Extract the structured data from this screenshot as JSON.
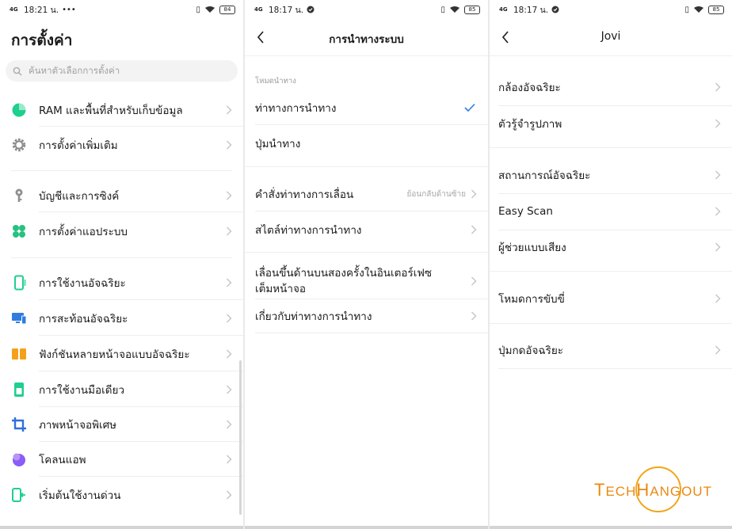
{
  "screen1": {
    "status": {
      "signal": "4G",
      "time": "18:21 น.",
      "extra": "•••",
      "battery": "84"
    },
    "title": "การตั้งค่า",
    "search_placeholder": "ค้นหาตัวเลือกการตั้งค่า",
    "items": [
      {
        "label": "RAM และพื้นที่สำหรับเก็บข้อมูล",
        "icon": "storage-pie-icon",
        "color": "#1fcf8e"
      },
      {
        "label": "การตั้งค่าเพิ่มเติม",
        "icon": "gear-icon",
        "color": "#8f8f8f"
      },
      {
        "label": "บัญชีและการซิงค์",
        "icon": "key-icon",
        "color": "#8f8f8f"
      },
      {
        "label": "การตั้งค่าแอประบบ",
        "icon": "apps-clover-icon",
        "color": "#26c281"
      },
      {
        "label": "การใช้งานอัจฉริยะ",
        "icon": "phone-outline-icon",
        "color": "#1fcf8e"
      },
      {
        "label": "การสะท้อนอัจฉริยะ",
        "icon": "screen-mirror-icon",
        "color": "#2f7de1"
      },
      {
        "label": "ฟังก์ชันหลายหน้าจอแบบอัจฉริยะ",
        "icon": "split-screen-icon",
        "color": "#f5a01a"
      },
      {
        "label": "การใช้งานมือเดียว",
        "icon": "one-hand-icon",
        "color": "#1fcf8e"
      },
      {
        "label": "ภาพหน้าจอพิเศษ",
        "icon": "crop-icon",
        "color": "#2f6fe0"
      },
      {
        "label": "โคลนแอพ",
        "icon": "clone-app-icon",
        "color": "#8b5cf6"
      },
      {
        "label": "เริ่มต้นใช้งานด่วน",
        "icon": "quick-start-icon",
        "color": "#1fcf8e"
      }
    ]
  },
  "screen2": {
    "status": {
      "signal": "4G",
      "time": "18:17 น.",
      "battery": "85"
    },
    "title": "การนำทางระบบ",
    "section_header": "โหมดนำทาง",
    "items": [
      {
        "label": "ท่าทางการนำทาง",
        "selected": true
      },
      {
        "label": "ปุ่มนำทาง"
      },
      {
        "label": "คำสั่งท่าทางการเลื่อน",
        "hint": "ย้อนกลับด้านซ้าย"
      },
      {
        "label": "สไตล์ท่าทางการนำทาง"
      },
      {
        "label_line1": "เลื่อนขึ้นด้านบนสองครั้งในอินเตอร์เฟซ",
        "label_line2": "เต็มหน้าจอ"
      },
      {
        "label": "เกี่ยวกับท่าทางการนำทาง"
      }
    ],
    "accent": "#2f7de1"
  },
  "screen3": {
    "status": {
      "signal": "4G",
      "time": "18:17 น.",
      "battery": "85"
    },
    "title": "Jovi",
    "items": [
      {
        "label": "กล้องอัจฉริยะ"
      },
      {
        "label": "ตัวรู้จำรูปภาพ"
      },
      {
        "label": "สถานการณ์อัจฉริยะ"
      },
      {
        "label": "Easy Scan"
      },
      {
        "label": "ผู้ช่วยแบบเสียง"
      },
      {
        "label": "โหมดการขับขี่"
      },
      {
        "label": "ปุ่มกดอัจฉริยะ"
      }
    ]
  },
  "watermark": {
    "part1": "T",
    "part2": "ECH",
    "part3": "H",
    "part4": "ANGOUT",
    "color": "#e98a12"
  }
}
